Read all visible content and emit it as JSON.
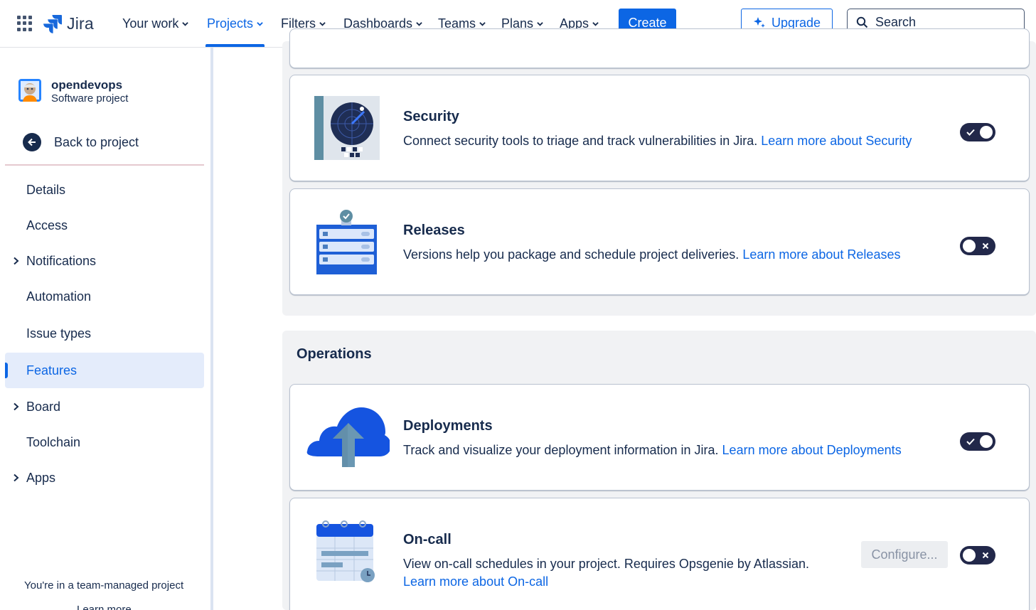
{
  "topnav": {
    "logo_text": "Jira",
    "items": [
      {
        "label": "Your work",
        "active": false
      },
      {
        "label": "Projects",
        "active": true
      },
      {
        "label": "Filters",
        "active": false
      },
      {
        "label": "Dashboards",
        "active": false
      },
      {
        "label": "Teams",
        "active": false
      },
      {
        "label": "Plans",
        "active": false
      },
      {
        "label": "Apps",
        "active": false
      }
    ],
    "create_label": "Create",
    "upgrade_label": "Upgrade",
    "search_placeholder": "Search",
    "accent_color": "#0c66e4"
  },
  "sidebar": {
    "project_name": "opendevops",
    "project_type": "Software project",
    "back_label": "Back to project",
    "items": [
      {
        "label": "Details",
        "expandable": false,
        "active": false
      },
      {
        "label": "Access",
        "expandable": false,
        "active": false
      },
      {
        "label": "Notifications",
        "expandable": true,
        "active": false
      },
      {
        "label": "Automation",
        "expandable": false,
        "active": false
      },
      {
        "label": "Issue types",
        "expandable": false,
        "active": false
      },
      {
        "label": "Features",
        "expandable": false,
        "active": true
      },
      {
        "label": "Board",
        "expandable": true,
        "active": false
      },
      {
        "label": "Toolchain",
        "expandable": false,
        "active": false
      },
      {
        "label": "Apps",
        "expandable": true,
        "active": false
      }
    ],
    "footer_text": "You're in a team-managed project",
    "footer_link_partial": "Learn more"
  },
  "features": {
    "security": {
      "title": "Security",
      "description": "Connect security tools to triage and track vulnerabilities in Jira.",
      "link": "Learn more about Security",
      "enabled": true
    },
    "releases": {
      "title": "Releases",
      "description": "Versions help you package and schedule project deliveries.",
      "link": "Learn more about Releases",
      "enabled": false
    }
  },
  "operations": {
    "section_title": "Operations",
    "deployments": {
      "title": "Deployments",
      "description": "Track and visualize your deployment information in Jira.",
      "link": "Learn more about Deployments",
      "enabled": true
    },
    "oncall": {
      "title": "On-call",
      "description": "View on-call schedules in your project. Requires Opsgenie by Atlassian.",
      "link": "Learn more about On-call",
      "configure_label": "Configure...",
      "enabled": false
    }
  }
}
